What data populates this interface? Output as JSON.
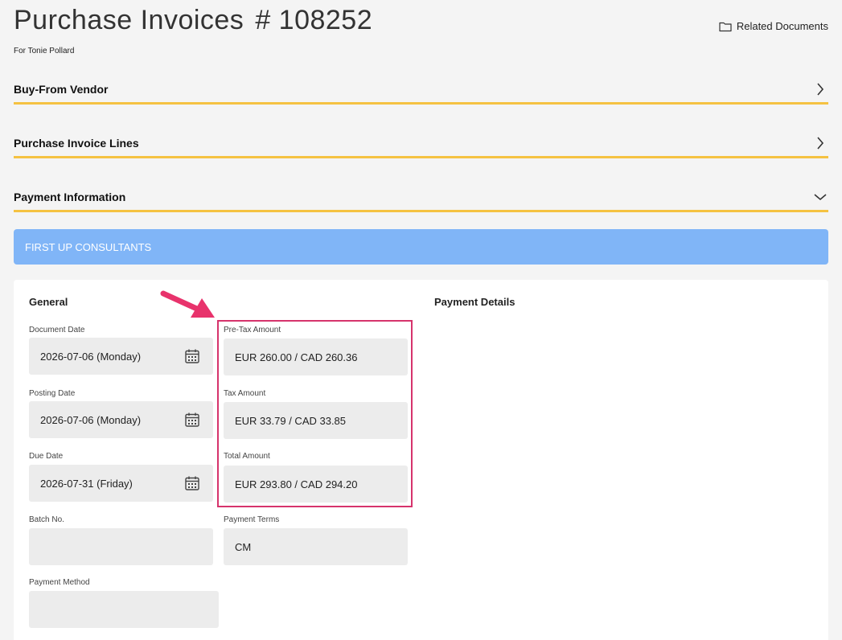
{
  "header": {
    "title": "Purchase Invoices",
    "number": "# 108252",
    "subtitle": "For Tonie Pollard",
    "related_label": "Related Documents"
  },
  "sections": [
    {
      "label": "Buy-From Vendor",
      "state": "collapsed"
    },
    {
      "label": "Purchase Invoice Lines",
      "state": "collapsed"
    },
    {
      "label": "Payment Information",
      "state": "expanded"
    }
  ],
  "banner": {
    "text": "FIRST UP CONSULTANTS"
  },
  "general": {
    "title": "General",
    "document_date": {
      "label": "Document Date",
      "value": "2026-07-06 (Monday)"
    },
    "posting_date": {
      "label": "Posting Date",
      "value": "2026-07-06 (Monday)"
    },
    "due_date": {
      "label": "Due Date",
      "value": "2026-07-31 (Friday)"
    },
    "batch_no": {
      "label": "Batch No.",
      "value": ""
    },
    "payment_method": {
      "label": "Payment Method",
      "value": ""
    },
    "pre_tax_amount": {
      "label": "Pre-Tax Amount",
      "value": "EUR 260.00 / CAD 260.36"
    },
    "tax_amount": {
      "label": "Tax Amount",
      "value": "EUR 33.79 / CAD 33.85"
    },
    "total_amount": {
      "label": "Total Amount",
      "value": "EUR 293.80 / CAD 294.20"
    },
    "payment_terms": {
      "label": "Payment Terms",
      "value": "CM"
    }
  },
  "payment_details": {
    "title": "Payment Details"
  },
  "colors": {
    "accent_underline": "#f5c242",
    "banner": "#80b5f7",
    "highlight": "#d6336c",
    "field_bg": "#ececec"
  }
}
